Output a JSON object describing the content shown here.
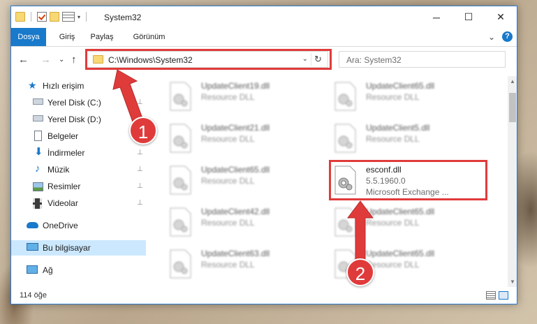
{
  "window": {
    "title": "System32",
    "controls": {
      "minimize": "─",
      "maximize": "☐",
      "close": "✕"
    }
  },
  "ribbon": {
    "tabs": [
      {
        "label": "Dosya",
        "active": true
      },
      {
        "label": "Giriş",
        "active": false
      },
      {
        "label": "Paylaş",
        "active": false
      },
      {
        "label": "Görünüm",
        "active": false
      }
    ],
    "expand_glyph": "⌄",
    "help_glyph": "?"
  },
  "nav": {
    "back_glyph": "←",
    "forward_glyph": "→",
    "recent_glyph": "⌄",
    "up_glyph": "↑",
    "address_path": "C:\\Windows\\System32",
    "address_dropdown_glyph": "⌄",
    "refresh_glyph": "↻",
    "search_placeholder": "Ara: System32"
  },
  "sidebar": {
    "items": [
      {
        "label": "Hızlı erişim",
        "icon": "star-icon",
        "pinned": false
      },
      {
        "label": "Yerel Disk (C:)",
        "icon": "drive-icon",
        "pinned": true
      },
      {
        "label": "Yerel Disk (D:)",
        "icon": "drive-icon",
        "pinned": true
      },
      {
        "label": "Belgeler",
        "icon": "documents-icon",
        "pinned": true
      },
      {
        "label": "İndirmeler",
        "icon": "download-icon",
        "pinned": true
      },
      {
        "label": "Müzik",
        "icon": "music-icon",
        "pinned": true
      },
      {
        "label": "Resimler",
        "icon": "pictures-icon",
        "pinned": true
      },
      {
        "label": "Videolar",
        "icon": "videos-icon",
        "pinned": true
      },
      {
        "label": "OneDrive",
        "icon": "cloud-icon",
        "pinned": false
      },
      {
        "label": "Bu bilgisayar",
        "icon": "computer-icon",
        "pinned": false,
        "selected": true
      },
      {
        "label": "Ağ",
        "icon": "network-icon",
        "pinned": false
      }
    ],
    "pin_glyph": "📌"
  },
  "files": [
    {
      "name": "UpdateClient19.dll",
      "type": "Resource DLL"
    },
    {
      "name": "UpdateClient65.dll",
      "type": "Resource DLL"
    },
    {
      "name": "UpdateClient21.dll",
      "type": "Resource DLL"
    },
    {
      "name": "UpdateClient5.dll",
      "type": "Resource DLL"
    },
    {
      "name": "UpdateClient65.dll",
      "type": "Resource DLL"
    },
    {
      "name": "esconf.dll",
      "type": "5.5.1960.0",
      "description": "Microsoft Exchange ...",
      "highlighted": true
    },
    {
      "name": "UpdateClient42.dll",
      "type": "Resource DLL"
    },
    {
      "name": "UpdateClient65.dll",
      "type": "Resource DLL"
    },
    {
      "name": "UpdateClient63.dll",
      "type": "Resource DLL"
    },
    {
      "name": "UpdateClient65.dll",
      "type": "Resource DLL"
    }
  ],
  "status": {
    "item_count": "114 öğe"
  },
  "annotations": {
    "badge1": "1",
    "badge2": "2",
    "color": "#e03b3b"
  }
}
